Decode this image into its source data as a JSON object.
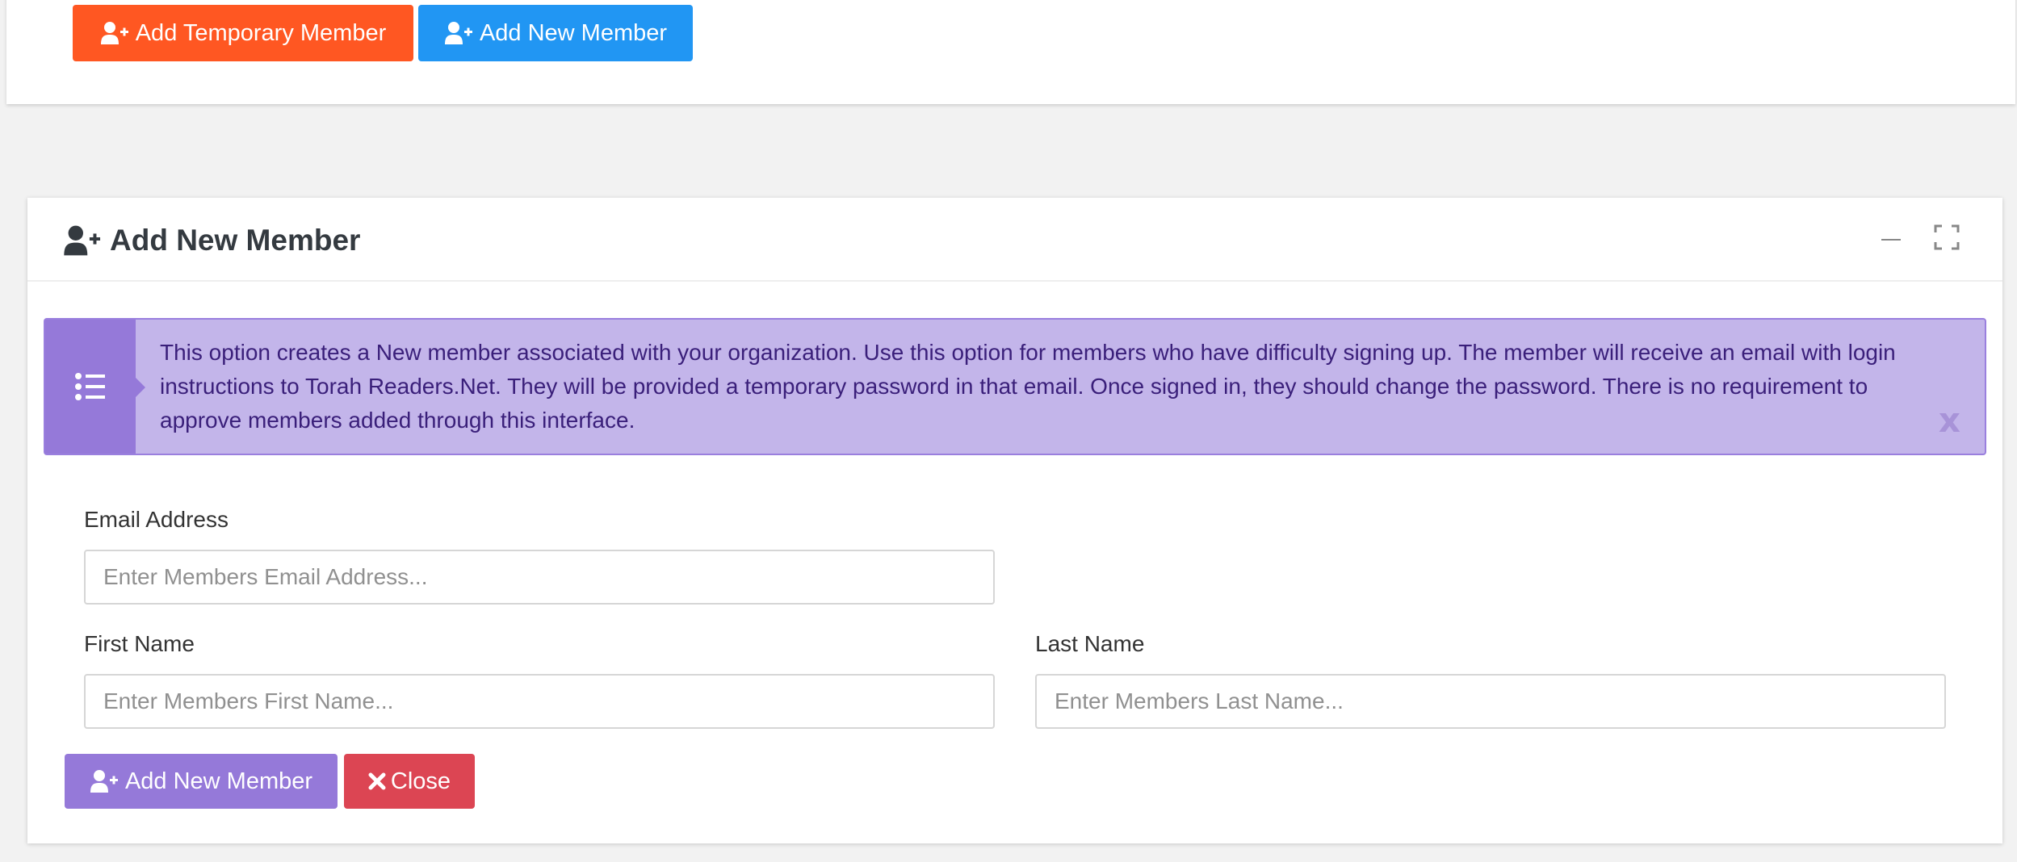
{
  "top_toolbar": {
    "add_temporary_member_label": "Add Temporary Member",
    "add_new_member_label": "Add New Member"
  },
  "panel": {
    "title": "Add New Member",
    "icon": "user-plus-icon",
    "tools": [
      "minimize-icon",
      "maximize-icon"
    ]
  },
  "callout": {
    "icon": "list-icon",
    "text": "This option creates a New member associated with your organization. Use this option for members who have difficulty signing up. The member will receive an email with login instructions to Torah Readers.Net. They will be provided a temporary password in that email. Once signed in, they should change the password. There is no requirement to approve members added through this interface.",
    "close_label": "x"
  },
  "form": {
    "email": {
      "label": "Email Address",
      "value": "",
      "placeholder": "Enter Members Email Address..."
    },
    "first_name": {
      "label": "First Name",
      "value": "",
      "placeholder": "Enter Members First Name..."
    },
    "last_name": {
      "label": "Last Name",
      "value": "",
      "placeholder": "Enter Members Last Name..."
    },
    "submit_label": "Add New Member",
    "close_label": "Close"
  },
  "colors": {
    "temporary_button": "#ff5722",
    "new_member_button": "#2196f3",
    "submit_button": "#9579d9",
    "close_button": "#dc4553",
    "callout_bg": "#c3b5ea",
    "callout_text": "#3a1f7a"
  }
}
